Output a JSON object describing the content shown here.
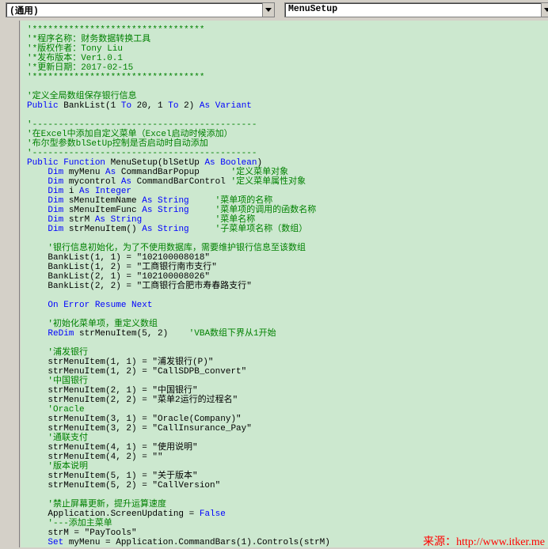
{
  "toolbar": {
    "object_combo": "(通用)",
    "proc_combo": "MenuSetup"
  },
  "code_lines": [
    {
      "kind": "cm",
      "text": "'*********************************"
    },
    {
      "kind": "cm",
      "text": "'*程序名称：财务数据转换工具"
    },
    {
      "kind": "cm",
      "text": "'*版权作者：Tony Liu"
    },
    {
      "kind": "cm",
      "text": "'*发布版本：Ver1.0.1"
    },
    {
      "kind": "cm",
      "text": "'*更新日期：2017-02-15"
    },
    {
      "kind": "cm",
      "text": "'*********************************"
    },
    {
      "kind": "blank",
      "text": ""
    },
    {
      "kind": "cm",
      "text": "'定义全局数组保存银行信息"
    },
    {
      "kind": "mixed",
      "parts": [
        {
          "k": "kw",
          "t": "Public "
        },
        {
          "k": "",
          "t": "BankList(1 "
        },
        {
          "k": "kw",
          "t": "To "
        },
        {
          "k": "",
          "t": "20, 1 "
        },
        {
          "k": "kw",
          "t": "To "
        },
        {
          "k": "",
          "t": "2) "
        },
        {
          "k": "kw",
          "t": "As Variant"
        }
      ]
    },
    {
      "kind": "blank",
      "text": ""
    },
    {
      "kind": "cm",
      "text": "'-------------------------------------------"
    },
    {
      "kind": "cm",
      "text": "'在Excel中添加自定义菜单（Excel启动时候添加）"
    },
    {
      "kind": "cm",
      "text": "'布尔型参数blSetUp控制是否启动时自动添加"
    },
    {
      "kind": "cm",
      "text": "'-------------------------------------------"
    },
    {
      "kind": "mixed",
      "parts": [
        {
          "k": "kw",
          "t": "Public Function "
        },
        {
          "k": "",
          "t": "MenuSetup(blSetUp "
        },
        {
          "k": "kw",
          "t": "As Boolean"
        },
        {
          "k": "",
          "t": ")"
        }
      ]
    },
    {
      "kind": "mixed",
      "parts": [
        {
          "k": "kw",
          "t": "    Dim "
        },
        {
          "k": "",
          "t": "myMenu "
        },
        {
          "k": "kw",
          "t": "As "
        },
        {
          "k": "",
          "t": "CommandBarPopup      "
        },
        {
          "k": "cm",
          "t": "'定义菜单对象"
        }
      ]
    },
    {
      "kind": "mixed",
      "parts": [
        {
          "k": "kw",
          "t": "    Dim "
        },
        {
          "k": "",
          "t": "mycontrol "
        },
        {
          "k": "kw",
          "t": "As "
        },
        {
          "k": "",
          "t": "CommandBarControl "
        },
        {
          "k": "cm",
          "t": "'定义菜单属性对象"
        }
      ]
    },
    {
      "kind": "mixed",
      "parts": [
        {
          "k": "kw",
          "t": "    Dim "
        },
        {
          "k": "",
          "t": "i "
        },
        {
          "k": "kw",
          "t": "As Integer"
        }
      ]
    },
    {
      "kind": "mixed",
      "parts": [
        {
          "k": "kw",
          "t": "    Dim "
        },
        {
          "k": "",
          "t": "sMenuItemName "
        },
        {
          "k": "kw",
          "t": "As String     "
        },
        {
          "k": "cm",
          "t": "'菜单项的名称"
        }
      ]
    },
    {
      "kind": "mixed",
      "parts": [
        {
          "k": "kw",
          "t": "    Dim "
        },
        {
          "k": "",
          "t": "sMenuItemFunc "
        },
        {
          "k": "kw",
          "t": "As String     "
        },
        {
          "k": "cm",
          "t": "'菜单项的调用的函数名称"
        }
      ]
    },
    {
      "kind": "mixed",
      "parts": [
        {
          "k": "kw",
          "t": "    Dim "
        },
        {
          "k": "",
          "t": "strM "
        },
        {
          "k": "kw",
          "t": "As String              "
        },
        {
          "k": "cm",
          "t": "'菜单名称"
        }
      ]
    },
    {
      "kind": "mixed",
      "parts": [
        {
          "k": "kw",
          "t": "    Dim "
        },
        {
          "k": "",
          "t": "strMenuItem() "
        },
        {
          "k": "kw",
          "t": "As String     "
        },
        {
          "k": "cm",
          "t": "'子菜单项名称（数组）"
        }
      ]
    },
    {
      "kind": "blank",
      "text": ""
    },
    {
      "kind": "cm",
      "text": "    '银行信息初始化，为了不使用数据库，需要维护银行信息至该数组"
    },
    {
      "kind": "plain",
      "text": "    BankList(1, 1) = \"102100008018\""
    },
    {
      "kind": "plain",
      "text": "    BankList(1, 2) = \"工商银行南市支行\""
    },
    {
      "kind": "plain",
      "text": "    BankList(2, 1) = \"102100008026\""
    },
    {
      "kind": "plain",
      "text": "    BankList(2, 2) = \"工商银行合肥市寿春路支行\""
    },
    {
      "kind": "blank",
      "text": ""
    },
    {
      "kind": "kw",
      "text": "    On Error Resume Next"
    },
    {
      "kind": "blank",
      "text": ""
    },
    {
      "kind": "cm",
      "text": "    '初始化菜单项，重定义数组"
    },
    {
      "kind": "mixed",
      "parts": [
        {
          "k": "kw",
          "t": "    ReDim "
        },
        {
          "k": "",
          "t": "strMenuItem(5, 2)    "
        },
        {
          "k": "cm",
          "t": "'VBA数组下界从1开始"
        }
      ]
    },
    {
      "kind": "blank",
      "text": ""
    },
    {
      "kind": "cm",
      "text": "    '浦发银行"
    },
    {
      "kind": "plain",
      "text": "    strMenuItem(1, 1) = \"浦发银行(P)\""
    },
    {
      "kind": "plain",
      "text": "    strMenuItem(1, 2) = \"CallSDPB_convert\""
    },
    {
      "kind": "cm",
      "text": "    '中国银行"
    },
    {
      "kind": "plain",
      "text": "    strMenuItem(2, 1) = \"中国银行\""
    },
    {
      "kind": "plain",
      "text": "    strMenuItem(2, 2) = \"菜单2运行的过程名\""
    },
    {
      "kind": "cm",
      "text": "    'Oracle"
    },
    {
      "kind": "plain",
      "text": "    strMenuItem(3, 1) = \"Oracle(Company)\""
    },
    {
      "kind": "plain",
      "text": "    strMenuItem(3, 2) = \"CallInsurance_Pay\""
    },
    {
      "kind": "cm",
      "text": "    '通联支付"
    },
    {
      "kind": "plain",
      "text": "    strMenuItem(4, 1) = \"使用说明\""
    },
    {
      "kind": "plain",
      "text": "    strMenuItem(4, 2) = \"\""
    },
    {
      "kind": "cm",
      "text": "    '版本说明"
    },
    {
      "kind": "plain",
      "text": "    strMenuItem(5, 1) = \"关于版本\""
    },
    {
      "kind": "plain",
      "text": "    strMenuItem(5, 2) = \"CallVersion\""
    },
    {
      "kind": "blank",
      "text": ""
    },
    {
      "kind": "cm",
      "text": "    '禁止屏幕更新，提升运算速度"
    },
    {
      "kind": "mixed",
      "parts": [
        {
          "k": "",
          "t": "    Application.ScreenUpdating = "
        },
        {
          "k": "kw",
          "t": "False"
        }
      ]
    },
    {
      "kind": "cm",
      "text": "    '---添加主菜单"
    },
    {
      "kind": "plain",
      "text": "    strM = \"PayTools\""
    },
    {
      "kind": "mixed",
      "parts": [
        {
          "k": "kw",
          "t": "    Set "
        },
        {
          "k": "",
          "t": "myMenu = Application.CommandBars(1).Controls(strM)"
        }
      ]
    }
  ],
  "watermark": "来源：http://www.itker.me"
}
